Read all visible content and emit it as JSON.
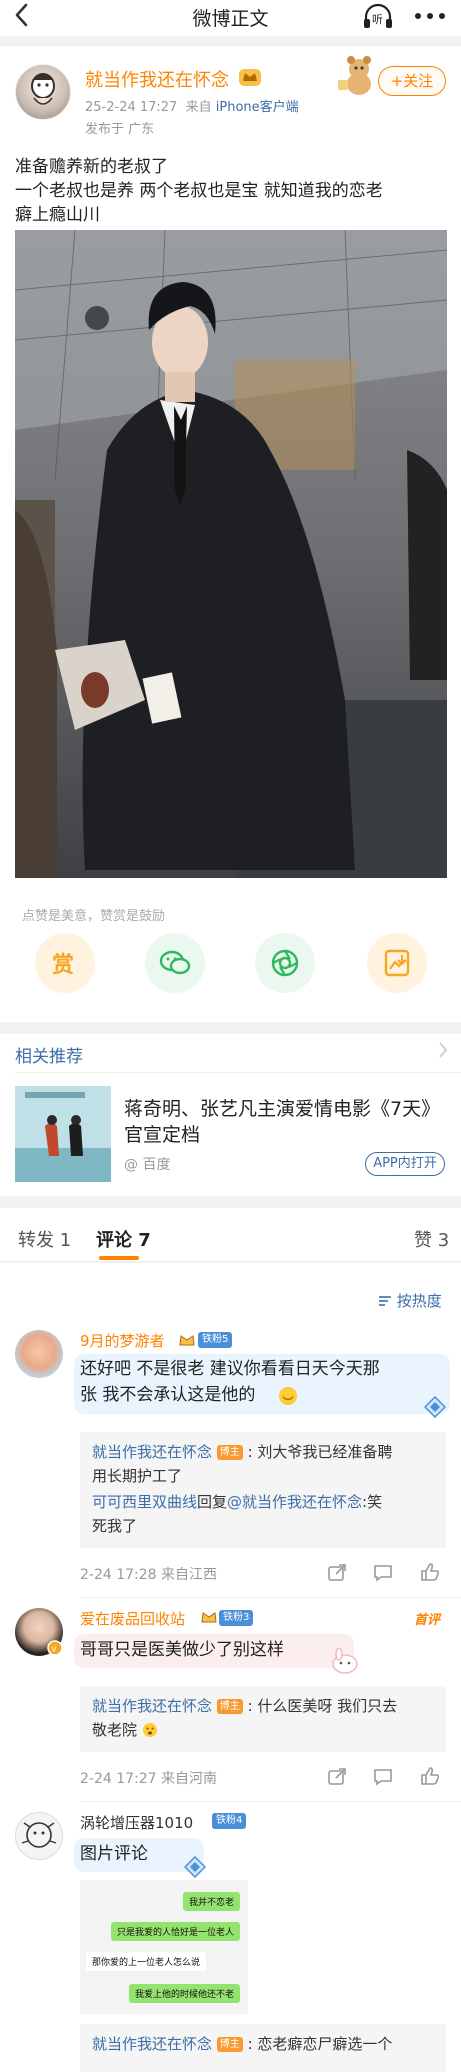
{
  "nav": {
    "back_icon": "chevron-left-icon",
    "title": "微博正文",
    "listen_label": "听",
    "more_icon": "more-icon"
  },
  "post": {
    "author": "就当作我还在怀念",
    "timestamp": "25-2-24 17:27",
    "source_prefix": "来自",
    "source": "iPhone客户端",
    "location": "发布于 广东",
    "follow_label": "+关注",
    "text_lines": [
      "准备赡养新的老叔了",
      "一个老叔也是养 两个老叔也是宝 就知道我的恋老",
      "癖上瘾山川"
    ],
    "reward_hint": "点赞是美意，赞赏是鼓励",
    "reward_label": "赏"
  },
  "related": {
    "title": "相关推荐",
    "headline_line1": "蒋奇明、张艺凡主演爱情电影《7天》",
    "headline_line2": "官宣定档",
    "source": "@ 百度",
    "app_button": "APP内打开"
  },
  "tabs": {
    "forward": "转发 1",
    "comments": "评论 7",
    "likes": "赞 3"
  },
  "sort_label": "按热度",
  "comments": [
    {
      "name": "9月的梦游者",
      "level": "铁粉5",
      "text_line1": "还好吧 不是很老 建议你看看日天今天那",
      "text_line2": "张 我不会承认这是他的",
      "replies": [
        {
          "name": "就当作我还在怀念",
          "tag": "博主",
          "text": ": 刘大爷我已经准备聘",
          "cont": "用长期护工了"
        },
        {
          "name": "可可西里双曲线",
          "mid": "回复",
          "target": "@就当作我还在怀念",
          "text": ":笑",
          "cont": "死我了"
        }
      ],
      "date": "2-24 17:28",
      "from": "来自江西"
    },
    {
      "name": "爱在废品回收站",
      "level": "铁粉3",
      "first": "首评",
      "text_line1": "哥哥只是医美做少了别这样",
      "replies": [
        {
          "name": "就当作我还在怀念",
          "tag": "博主",
          "text": ": 什么医美呀 我们只去",
          "cont": "敬老院"
        }
      ],
      "date": "2-24 17:27",
      "from": "来自河南"
    },
    {
      "name": "涡轮增压器1010",
      "level": "铁粉4",
      "text_line1": "图片评论",
      "chat": [
        "我并不恋老",
        "只是我爱的人恰好是一位老人",
        "那你爱的上一位老人怎么说",
        "我爱上他的时候他还不老"
      ],
      "replies": [
        {
          "name": "就当作我还在怀念",
          "tag": "博主",
          "text": ": 恋老癖恋尸癖选一个"
        }
      ]
    }
  ]
}
